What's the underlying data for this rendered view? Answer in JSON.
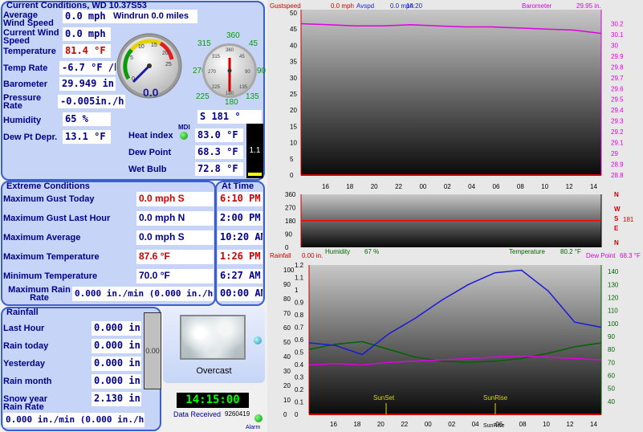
{
  "current": {
    "title": "Current Conditions, WD 10.37S53",
    "avg_wind_label": "Average Wind Speed",
    "avg_wind_value": "0.0 mph",
    "windrun": "Windrun 0.0 miles",
    "cur_wind_label": "Current Wind Speed",
    "cur_wind_value": "0.0 mph",
    "temp_label": "Temperature",
    "temp_value": "81.4 °F",
    "temp_rate_label": "Temp Rate",
    "temp_rate_value": "-6.7 °F /hr",
    "baro_label": "Barometer",
    "baro_value": "29.949 in.",
    "press_rate_label": "Pressure Rate",
    "press_rate_value": "-0.005in./hr",
    "humidity_label": "Humidity",
    "humidity_value": "65 %",
    "dew_depr_label": "Dew Pt Depr.",
    "dew_depr_value": "13.1 °F",
    "wind_dir_value": "S  181 °",
    "heat_index_label": "Heat index",
    "heat_index_value": "83.0 °F",
    "dew_point_label": "Dew Point",
    "dew_point_value": "68.3 °F",
    "wet_bulb_label": "Wet Bulb",
    "wet_bulb_value": "72.8 °F",
    "mdi_label": "MDI",
    "uv_value": "1.1",
    "speed_gauge_value": "0.0",
    "speed_gauge_ticks": [
      "0",
      "5",
      "10",
      "15",
      "20",
      "25"
    ],
    "compass_labels": {
      "n": "360",
      "ne": "45",
      "e": "90",
      "se": "135",
      "s": "180",
      "sw": "225",
      "w": "270",
      "nw": "315"
    },
    "compass_inner": [
      "315",
      "45",
      "270",
      "90",
      "225",
      "135",
      "360",
      "180"
    ]
  },
  "extreme": {
    "title": "Extreme Conditions",
    "at_time_title": "At Time",
    "rows": [
      {
        "label": "Maximum Gust Today",
        "value": "0.0 mph   S",
        "time": "6:10 PM",
        "red": true
      },
      {
        "label": "Maximum Gust Last Hour",
        "value": "0.0 mph   N",
        "time": "2:00 PM",
        "red": false
      },
      {
        "label": "Maximum Average",
        "value": "0.0 mph   S",
        "time": "10:20 AM",
        "red": false
      },
      {
        "label": "Maximum Temperature",
        "value": "87.6 °F",
        "time": "1:26 PM",
        "red": true
      },
      {
        "label": "Minimum Temperature",
        "value": "70.0 °F",
        "time": "6:27 AM",
        "red": false
      }
    ],
    "max_rain_label": "Maximum Rain Rate",
    "max_rain_value": "0.000 in./min (0.000 in./hr)",
    "max_rain_time": "00:00 AM"
  },
  "rainfall": {
    "title": "Rainfall",
    "rows": [
      {
        "label": "Last Hour",
        "value": "0.000 in."
      },
      {
        "label": "Rain today",
        "value": "0.000 in."
      },
      {
        "label": "Yesterday",
        "value": "0.000 in."
      },
      {
        "label": "Rain month",
        "value": "0.000 in."
      },
      {
        "label": "Snow year",
        "value": "2.130 in."
      }
    ],
    "rain_rate_label": "Rain Rate",
    "rain_rate_value": "0.000 in./min (0.000 in./hr)",
    "gauge_value": "0.00"
  },
  "weather": {
    "condition": "Overcast",
    "clock": "14:15:00",
    "data_received_label": "Data Received",
    "data_received_count": "9260419",
    "alarm_label": "Alarm"
  },
  "charts": {
    "top": {
      "gustspeed_label": "Gustspeed",
      "gustspeed_value": "0.0 mph",
      "avspd_label": "Avspd",
      "avspd_value": "0.0 mph",
      "time_label": "14:20",
      "barometer_label": "Barometer",
      "barometer_value": "29.95 in."
    },
    "mid": {
      "humidity_label": "Humidity",
      "humidity_value": "67 %",
      "temperature_label": "Temperature",
      "temperature_value": "80.2 °F",
      "compass_letters": [
        "N",
        "W",
        "S",
        "E",
        "N"
      ],
      "dir_value": "181"
    },
    "bottom": {
      "rainfall_label": "Rainfall",
      "rainfall_value": "0.00 in.",
      "dewpoint_label": "Dew Point",
      "dewpoint_value": "68.3 °F",
      "sunset_label": "SunSet",
      "sunrise_label": "SunRise",
      "sunrise2_label": "SunRise"
    },
    "colors": {
      "wind": "#ff0000",
      "baro": "#e000e0",
      "temp": "#1a1ad8",
      "hum": "#006400",
      "dew": "#e000e0",
      "rain": "#1a1ad8"
    }
  },
  "chart_data": [
    {
      "type": "line",
      "title": "",
      "x": [
        "16",
        "18",
        "20",
        "22",
        "00",
        "02",
        "04",
        "06",
        "08",
        "10",
        "12",
        "14"
      ],
      "series": [
        {
          "name": "Barometer",
          "axis": "right",
          "values": [
            30.2,
            30.19,
            30.18,
            30.18,
            30.19,
            30.18,
            30.17,
            30.17,
            30.16,
            30.15,
            30.14,
            30.11
          ]
        },
        {
          "name": "Gustspeed",
          "axis": "left",
          "values": [
            0,
            0,
            0,
            0,
            0,
            0,
            0,
            0,
            0,
            0,
            0,
            0
          ]
        }
      ],
      "ylim_left": [
        0,
        50
      ],
      "ylim_right": [
        28.8,
        30.3
      ],
      "yticks_left": [
        "0",
        "5",
        "10",
        "15",
        "20",
        "25",
        "30",
        "35",
        "40",
        "45",
        "50"
      ],
      "yticks_right": [
        "28.8",
        "28.9",
        "29",
        "29.1",
        "29.2",
        "29.3",
        "29.4",
        "29.5",
        "29.6",
        "29.7",
        "29.8",
        "29.9",
        "30",
        "30.1",
        "30.2"
      ]
    },
    {
      "type": "line",
      "x": [
        "16",
        "18",
        "20",
        "22",
        "00",
        "02",
        "04",
        "06",
        "08",
        "10",
        "12",
        "14"
      ],
      "series": [
        {
          "name": "Wind direction",
          "values": [
            181,
            181,
            181,
            181,
            181,
            181,
            181,
            181,
            181,
            181,
            181,
            181
          ]
        }
      ],
      "ylim": [
        0,
        360
      ],
      "yticks": [
        "0",
        "90",
        "180",
        "270",
        "360"
      ]
    },
    {
      "type": "line",
      "x": [
        "16",
        "18",
        "20",
        "22",
        "00",
        "02",
        "04",
        "06",
        "08",
        "10",
        "12",
        "14"
      ],
      "series": [
        {
          "name": "Temperature",
          "axis": "right",
          "values": [
            85,
            83,
            76,
            92,
            104,
            118,
            130,
            139,
            141,
            125,
            101,
            97
          ]
        },
        {
          "name": "Humidity",
          "axis": "right",
          "values": [
            80,
            84,
            86,
            80,
            74,
            71,
            70,
            71,
            73,
            77,
            82,
            85
          ]
        },
        {
          "name": "Dew Point",
          "axis": "right",
          "values": [
            68,
            69,
            68,
            70,
            71,
            72,
            73,
            74,
            75,
            74,
            73,
            72
          ]
        }
      ],
      "ylim_left": [
        0,
        1.2
      ],
      "ylim_right": [
        30,
        145
      ],
      "yticks_left": [
        "0",
        "0.1",
        "0.2",
        "0.3",
        "0.4",
        "0.5",
        "0.6",
        "0.7",
        "0.8",
        "0.9",
        "1",
        "1.1",
        "1.2"
      ],
      "yticks_right": [
        "40",
        "50",
        "60",
        "70",
        "80",
        "90",
        "100",
        "110",
        "120",
        "130",
        "140"
      ],
      "yticks_left_extra": [
        "0",
        "10",
        "20",
        "30",
        "40",
        "50",
        "60",
        "70",
        "80",
        "90",
        "100"
      ]
    }
  ]
}
